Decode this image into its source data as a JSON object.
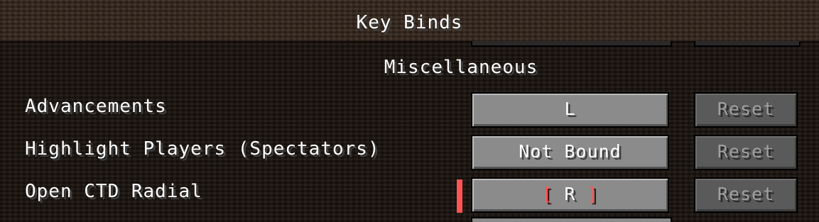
{
  "screen": {
    "title": "Key Binds"
  },
  "category": {
    "label": "Miscellaneous"
  },
  "rows": [
    {
      "label": "Advancements",
      "key": "L",
      "reset_label": "Reset"
    },
    {
      "label": "Highlight Players (Spectators)",
      "key": "Not Bound",
      "reset_label": "Reset"
    },
    {
      "label": "Open CTD Radial",
      "key": "R",
      "key_bracket_left": "[",
      "key_bracket_right": "]",
      "reset_label": "Reset",
      "conflict": true
    }
  ],
  "colors": {
    "background_dirt": "#3a2b20",
    "list_background": "#1f1712",
    "button": "#8b8b8b",
    "button_disabled": "#5a5a5a",
    "conflict": "#ff5555",
    "text": "#ffffff",
    "text_disabled": "#a0a0a0"
  }
}
